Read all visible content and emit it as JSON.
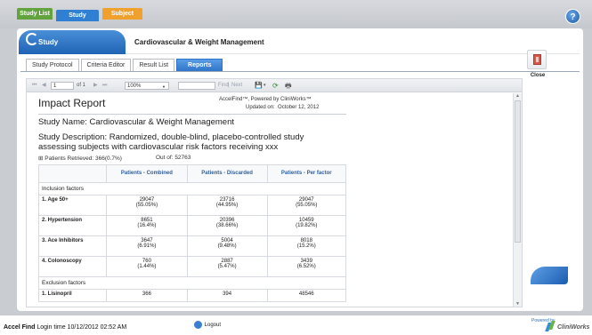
{
  "top_tabs": [
    {
      "label": "Study List"
    },
    {
      "label": "Study"
    },
    {
      "label": "Subject"
    }
  ],
  "help_label": "?",
  "study_panel": {
    "tab_label": "Study",
    "title": "Cardiovascular & Weight Management"
  },
  "sub_tabs": [
    {
      "label": "Study Protocol"
    },
    {
      "label": "Criteria Editor"
    },
    {
      "label": "Result List"
    },
    {
      "label": "Reports"
    }
  ],
  "toolbar": {
    "first_icon": "⏮",
    "prev_icon": "◀",
    "page_value": "1",
    "page_of": "of 1",
    "next_icon": "▶",
    "last_icon": "⏭",
    "zoom_value": "100%",
    "zoom_caret": "▼",
    "find_value": "",
    "find_label": "Find",
    "separator": "|",
    "next_label": "Next",
    "save_icon": "💾",
    "save_caret": "▾",
    "refresh_icon": "⟳",
    "print_icon": "🖶"
  },
  "report": {
    "title": "Impact Report",
    "powered": "AccelFind™, Powered by CliniWorks™",
    "updated_label": "Updated on:",
    "updated_date": "October 12, 2012",
    "study_name": "Study Name: Cardiovascular & Weight Management",
    "description": "Study Description: Randomized, double-blind, placebo-controlled study assessing subjects with cardiovascular risk factors receiving xxx",
    "retrieved": "⊞ Patients Retrieved: 366(0.7%)",
    "out_of": "Out of: 52763",
    "columns": [
      "",
      "Patients - Combined",
      "Patients - Discarded",
      "Patients - Per factor"
    ],
    "inclusion_label": "Inclusion factors",
    "inclusion_rows": [
      {
        "label": "1. Age 50+",
        "combined": "29047",
        "combined_pct": "(55.05%)",
        "discarded": "23716",
        "discarded_pct": "(44.95%)",
        "per_factor": "29047",
        "per_factor_pct": "(55.05%)"
      },
      {
        "label": "2. Hypertension",
        "combined": "8651",
        "combined_pct": "(16.4%)",
        "discarded": "20396",
        "discarded_pct": "(38.66%)",
        "per_factor": "10459",
        "per_factor_pct": "(19.82%)"
      },
      {
        "label": "3. Ace Inhibitors",
        "combined": "3647",
        "combined_pct": "(6.91%)",
        "discarded": "5004",
        "discarded_pct": "(9.48%)",
        "per_factor": "8018",
        "per_factor_pct": "(15.2%)"
      },
      {
        "label": "4. Colonoscopy",
        "combined": "760",
        "combined_pct": "(1.44%)",
        "discarded": "2887",
        "discarded_pct": "(5.47%)",
        "per_factor": "3439",
        "per_factor_pct": "(6.52%)"
      }
    ],
    "exclusion_label": "Exclusion factors",
    "exclusion_rows": [
      {
        "label": "1. Lisinopril",
        "combined": "366",
        "discarded": "394",
        "per_factor": "48546"
      }
    ]
  },
  "close_label": "Close",
  "footer": {
    "brand": "Accel Find",
    "login": "Login time 10/12/2012 02:52 AM",
    "logout": "Logout",
    "powered_by": "Powered by",
    "vendor": "CliniWorks"
  },
  "colors": {
    "accent_blue": "#2f7fd3",
    "study_list_green": "#62a33d",
    "subject_orange": "#f0a02c"
  }
}
